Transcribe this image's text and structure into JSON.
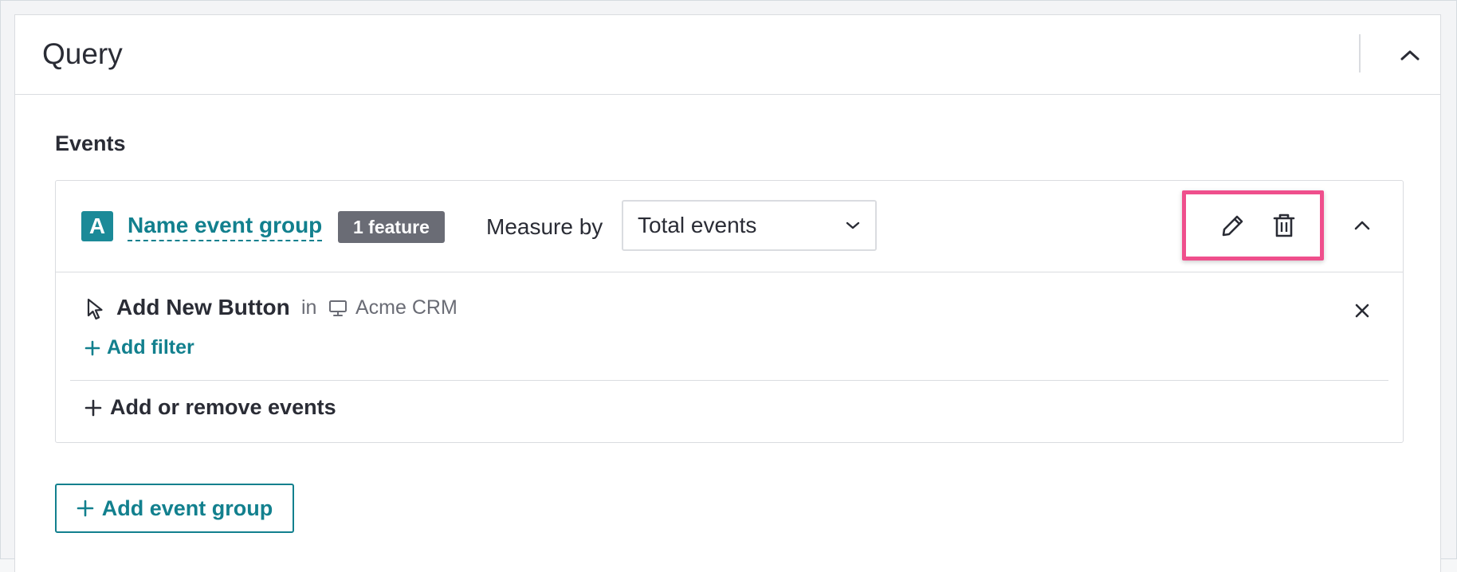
{
  "panel": {
    "title": "Query"
  },
  "events_section": {
    "label": "Events"
  },
  "event_group": {
    "letter": "A",
    "name": "Name event group",
    "badge": "1 feature",
    "measure_label": "Measure by",
    "measure_value": "Total events",
    "event": {
      "name": "Add New Button",
      "in_label": "in",
      "app": "Acme CRM"
    },
    "add_filter_label": "Add filter",
    "add_remove_label": "Add or remove events"
  },
  "add_group_label": "Add event group",
  "colors": {
    "accent": "#12808e",
    "badge": "#6a6c75",
    "highlight": "#ef4f8c"
  },
  "icons": [
    "chevron-up-icon",
    "pencil-icon",
    "trash-icon",
    "cursor-icon",
    "monitor-icon",
    "close-icon",
    "plus-icon",
    "chevron-down-icon"
  ]
}
